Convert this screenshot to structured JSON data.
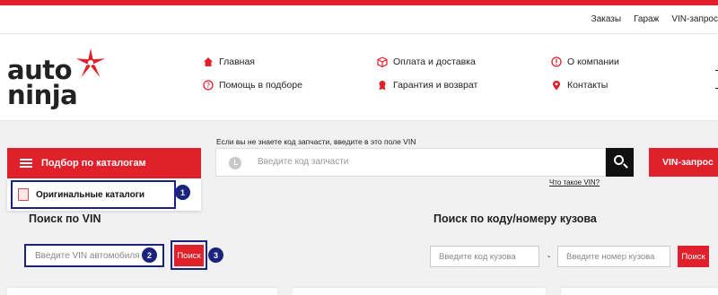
{
  "util_nav": [
    "Заказы",
    "Гараж",
    "VIN-запрос"
  ],
  "logo": {
    "line1": "auto",
    "line2": "ninja"
  },
  "nav": {
    "home": "Главная",
    "help": "Помощь в подборе",
    "payment": "Оплата и доставка",
    "warranty": "Гарантия и возврат",
    "about": "О компании",
    "contacts": "Контакты"
  },
  "catalog": {
    "button_label": "Подбор по каталогам",
    "dropdown_item": "Оригинальные каталоги"
  },
  "search": {
    "hint": "Если вы не знаете код запчасти, введите в это поле VIN",
    "placeholder": "Введите код запчасти",
    "what_is_vin": "Что такое VIN?",
    "vin_request": "VIN-запрос"
  },
  "vin_search": {
    "title": "Поиск по VIN",
    "placeholder": "Введите VIN автомобиля",
    "button": "Поиск"
  },
  "body_search": {
    "title": "Поиск по коду/номеру кузова",
    "code_placeholder": "Введите код кузова",
    "number_placeholder": "Введите номер кузова",
    "separator": "-",
    "button": "Поиск"
  },
  "badges": [
    "1",
    "2",
    "3"
  ],
  "colors": {
    "accent": "#e0202a",
    "highlight": "#1a237e"
  }
}
